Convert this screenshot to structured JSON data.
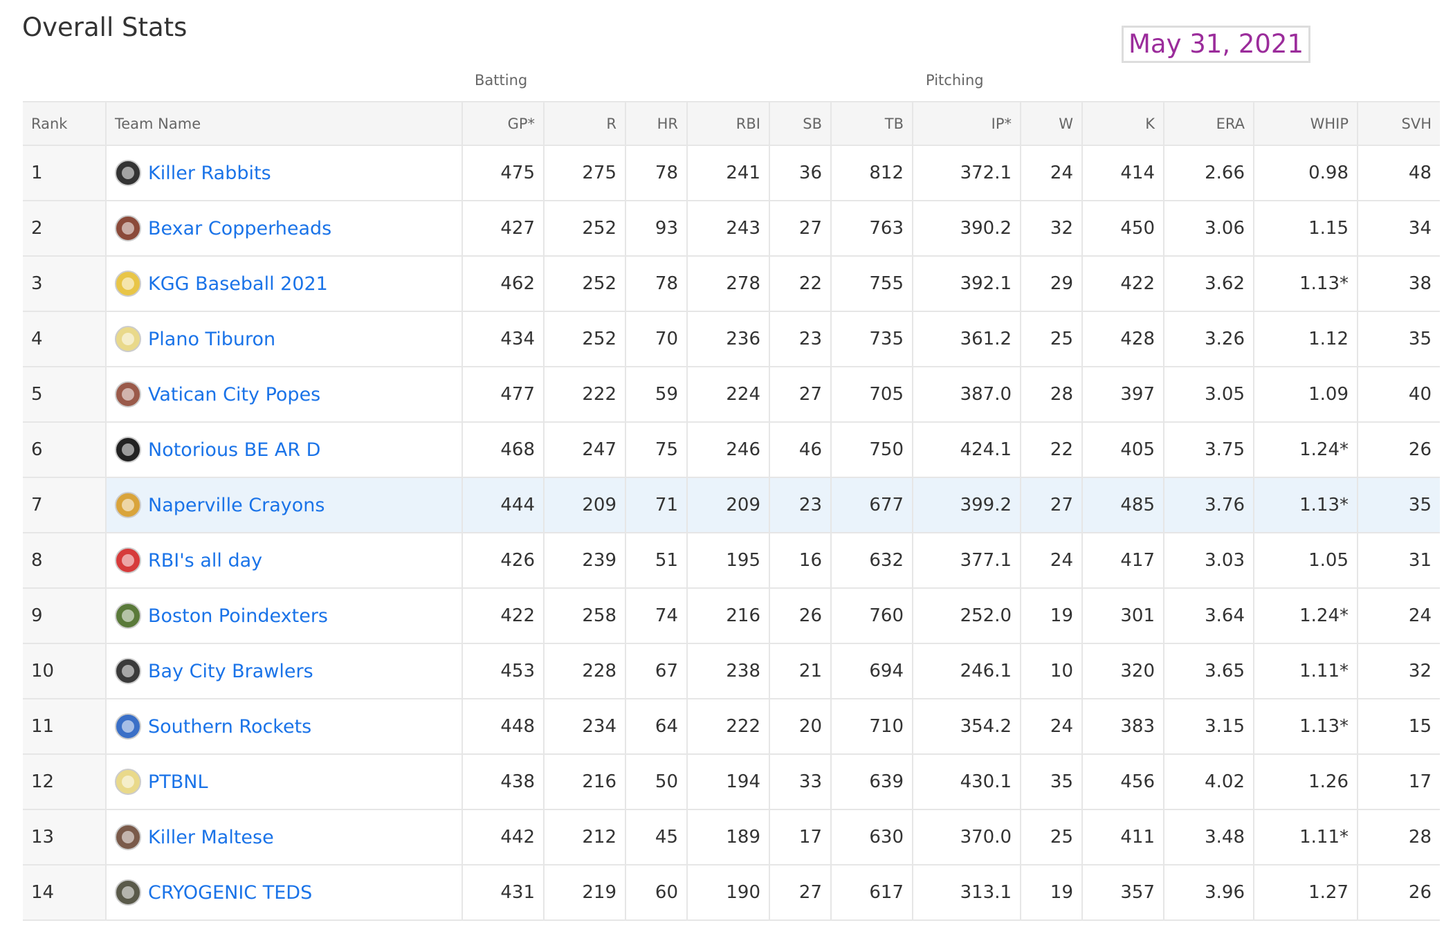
{
  "page": {
    "title": "Overall Stats",
    "date": "May 31, 2021"
  },
  "groups": {
    "batting": "Batting",
    "pitching": "Pitching"
  },
  "columns": [
    "Rank",
    "Team Name",
    "GP*",
    "R",
    "HR",
    "RBI",
    "SB",
    "TB",
    "IP*",
    "W",
    "K",
    "ERA",
    "WHIP",
    "SVH"
  ],
  "colors": {
    "link": "#1a73e8",
    "date": "#9b2c9b",
    "highlight_row": "#eaf3fb"
  },
  "rows": [
    {
      "rank": "1",
      "team": "Killer Rabbits",
      "logo": "rabbit-logo-icon",
      "logo_color": "#333333",
      "gp": "475",
      "r": "275",
      "hr": "78",
      "rbi": "241",
      "sb": "36",
      "tb": "812",
      "ip": "372.1",
      "w": "24",
      "k": "414",
      "era": "2.66",
      "whip": "0.98",
      "whip_flag": false,
      "svh": "48"
    },
    {
      "rank": "2",
      "team": "Bexar Copperheads",
      "logo": "snake-logo-icon",
      "logo_color": "#8b4a3a",
      "gp": "427",
      "r": "252",
      "hr": "93",
      "rbi": "243",
      "sb": "27",
      "tb": "763",
      "ip": "390.2",
      "w": "32",
      "k": "450",
      "era": "3.06",
      "whip": "1.15",
      "whip_flag": false,
      "svh": "34"
    },
    {
      "rank": "3",
      "team": "KGG Baseball 2021",
      "logo": "cap-logo-icon",
      "logo_color": "#e8c547",
      "gp": "462",
      "r": "252",
      "hr": "78",
      "rbi": "278",
      "sb": "22",
      "tb": "755",
      "ip": "392.1",
      "w": "29",
      "k": "422",
      "era": "3.62",
      "whip": "1.13*",
      "whip_flag": true,
      "svh": "38"
    },
    {
      "rank": "4",
      "team": "Plano Tiburon",
      "logo": "cap-logo-icon",
      "logo_color": "#e9d98a",
      "gp": "434",
      "r": "252",
      "hr": "70",
      "rbi": "236",
      "sb": "23",
      "tb": "735",
      "ip": "361.2",
      "w": "25",
      "k": "428",
      "era": "3.26",
      "whip": "1.12",
      "whip_flag": false,
      "svh": "35"
    },
    {
      "rank": "5",
      "team": "Vatican City Popes",
      "logo": "pope-logo-icon",
      "logo_color": "#9a5a4a",
      "gp": "477",
      "r": "222",
      "hr": "59",
      "rbi": "224",
      "sb": "27",
      "tb": "705",
      "ip": "387.0",
      "w": "28",
      "k": "397",
      "era": "3.05",
      "whip": "1.09",
      "whip_flag": false,
      "svh": "40"
    },
    {
      "rank": "6",
      "team": "Notorious BE AR D",
      "logo": "bear-logo-icon",
      "logo_color": "#222222",
      "gp": "468",
      "r": "247",
      "hr": "75",
      "rbi": "246",
      "sb": "46",
      "tb": "750",
      "ip": "424.1",
      "w": "22",
      "k": "405",
      "era": "3.75",
      "whip": "1.24*",
      "whip_flag": true,
      "svh": "26"
    },
    {
      "rank": "7",
      "team": "Naperville Crayons",
      "logo": "crayon-logo-icon",
      "logo_color": "#d9a43b",
      "gp": "444",
      "r": "209",
      "hr": "71",
      "rbi": "209",
      "sb": "23",
      "tb": "677",
      "ip": "399.2",
      "w": "27",
      "k": "485",
      "era": "3.76",
      "whip": "1.13*",
      "whip_flag": true,
      "svh": "35",
      "highlight": true
    },
    {
      "rank": "8",
      "team": "RBI's all day",
      "logo": "cap-logo-icon",
      "logo_color": "#d63b3b",
      "gp": "426",
      "r": "239",
      "hr": "51",
      "rbi": "195",
      "sb": "16",
      "tb": "632",
      "ip": "377.1",
      "w": "24",
      "k": "417",
      "era": "3.03",
      "whip": "1.05",
      "whip_flag": false,
      "svh": "31"
    },
    {
      "rank": "9",
      "team": "Boston Poindexters",
      "logo": "goblin-logo-icon",
      "logo_color": "#5a7a3a",
      "gp": "422",
      "r": "258",
      "hr": "74",
      "rbi": "216",
      "sb": "26",
      "tb": "760",
      "ip": "252.0",
      "w": "19",
      "k": "301",
      "era": "3.64",
      "whip": "1.24*",
      "whip_flag": true,
      "svh": "24"
    },
    {
      "rank": "10",
      "team": "Bay City Brawlers",
      "logo": "dog-logo-icon",
      "logo_color": "#3a3a3a",
      "gp": "453",
      "r": "228",
      "hr": "67",
      "rbi": "238",
      "sb": "21",
      "tb": "694",
      "ip": "246.1",
      "w": "10",
      "k": "320",
      "era": "3.65",
      "whip": "1.11*",
      "whip_flag": true,
      "svh": "32"
    },
    {
      "rank": "11",
      "team": "Southern Rockets",
      "logo": "rocket-logo-icon",
      "logo_color": "#3a6fc7",
      "gp": "448",
      "r": "234",
      "hr": "64",
      "rbi": "222",
      "sb": "20",
      "tb": "710",
      "ip": "354.2",
      "w": "24",
      "k": "383",
      "era": "3.15",
      "whip": "1.13*",
      "whip_flag": true,
      "svh": "15"
    },
    {
      "rank": "12",
      "team": "PTBNL",
      "logo": "cap-logo-icon",
      "logo_color": "#e9d98a",
      "gp": "438",
      "r": "216",
      "hr": "50",
      "rbi": "194",
      "sb": "33",
      "tb": "639",
      "ip": "430.1",
      "w": "35",
      "k": "456",
      "era": "4.02",
      "whip": "1.26",
      "whip_flag": false,
      "svh": "17"
    },
    {
      "rank": "13",
      "team": "Killer Maltese",
      "logo": "dog-logo-icon",
      "logo_color": "#7a5a4a",
      "gp": "442",
      "r": "212",
      "hr": "45",
      "rbi": "189",
      "sb": "17",
      "tb": "630",
      "ip": "370.0",
      "w": "25",
      "k": "411",
      "era": "3.48",
      "whip": "1.11*",
      "whip_flag": true,
      "svh": "28"
    },
    {
      "rank": "14",
      "team": "CRYOGENIC TEDS",
      "logo": "capsule-logo-icon",
      "logo_color": "#5a5a4a",
      "gp": "431",
      "r": "219",
      "hr": "60",
      "rbi": "190",
      "sb": "27",
      "tb": "617",
      "ip": "313.1",
      "w": "19",
      "k": "357",
      "era": "3.96",
      "whip": "1.27",
      "whip_flag": false,
      "svh": "26"
    }
  ]
}
